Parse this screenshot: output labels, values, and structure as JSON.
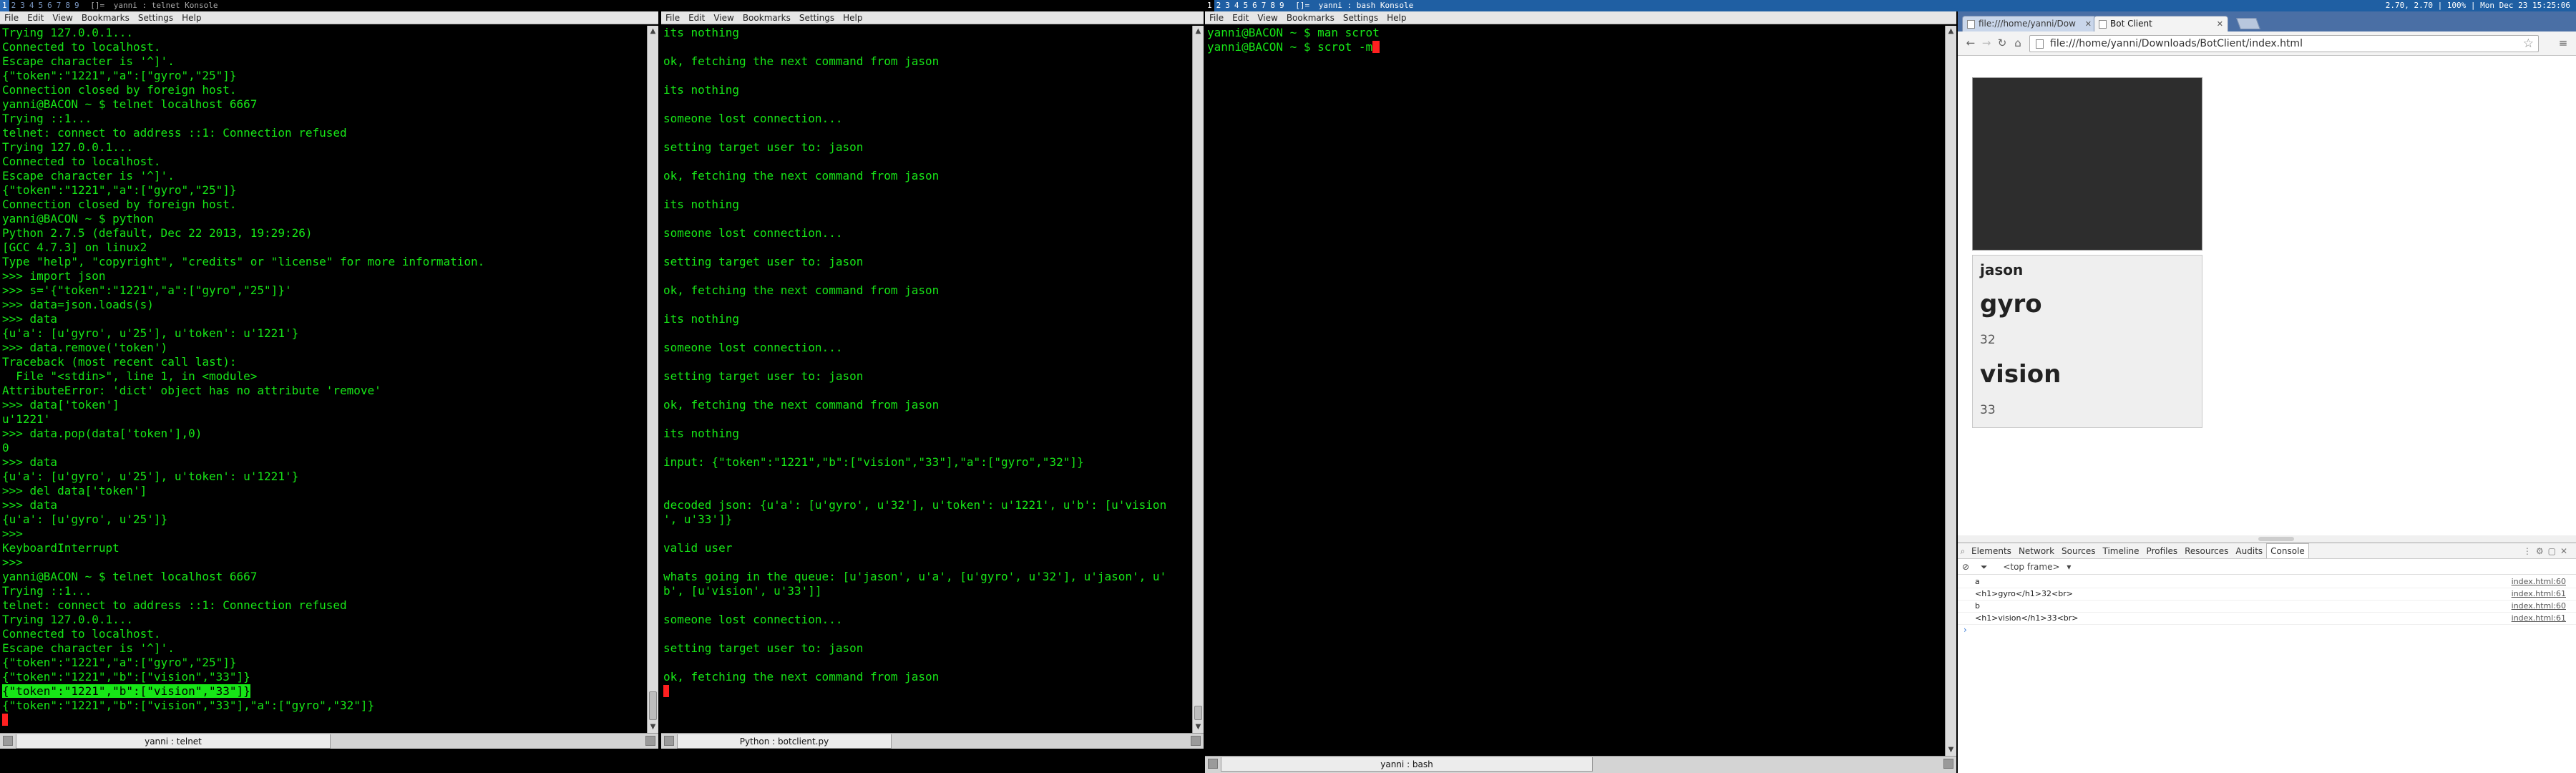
{
  "topbar": {
    "left_tags": [
      "1",
      "2",
      "3",
      "4",
      "5",
      "6",
      "7",
      "8",
      "9"
    ],
    "left_layout": "[]=",
    "left_title": "yanni : telnet  Konsole",
    "mid_tags": [
      "1",
      "2",
      "3",
      "4",
      "5",
      "6",
      "7",
      "8",
      "9"
    ],
    "mid_layout": "[]=",
    "mid_title": "yanni : bash  Konsole",
    "status": "2.70, 2.70 | 100% | Mon Dec 23 15:25:06"
  },
  "terminal1": {
    "menu": [
      "File",
      "Edit",
      "View",
      "Bookmarks",
      "Settings",
      "Help"
    ],
    "lines": [
      "Trying 127.0.0.1...",
      "Connected to localhost.",
      "Escape character is '^]'.",
      "{\"token\":\"1221\",\"a\":[\"gyro\",\"25\"]}",
      "Connection closed by foreign host.",
      "yanni@BACON ~ $ telnet localhost 6667",
      "Trying ::1...",
      "telnet: connect to address ::1: Connection refused",
      "Trying 127.0.0.1...",
      "Connected to localhost.",
      "Escape character is '^]'.",
      "{\"token\":\"1221\",\"a\":[\"gyro\",\"25\"]}",
      "Connection closed by foreign host.",
      "yanni@BACON ~ $ python",
      "Python 2.7.5 (default, Dec 22 2013, 19:29:26)",
      "[GCC 4.7.3] on linux2",
      "Type \"help\", \"copyright\", \"credits\" or \"license\" for more information.",
      ">>> import json",
      ">>> s='{\"token\":\"1221\",\"a\":[\"gyro\",\"25\"]}'",
      ">>> data=json.loads(s)",
      ">>> data",
      "{u'a': [u'gyro', u'25'], u'token': u'1221'}",
      ">>> data.remove('token')",
      "Traceback (most recent call last):",
      "  File \"<stdin>\", line 1, in <module>",
      "AttributeError: 'dict' object has no attribute 'remove'",
      ">>> data['token']",
      "u'1221'",
      ">>> data.pop(data['token'],0)",
      "0",
      ">>> data",
      "{u'a': [u'gyro', u'25'], u'token': u'1221'}",
      ">>> del data['token']",
      ">>> data",
      "{u'a': [u'gyro', u'25']}",
      ">>>",
      "KeyboardInterrupt",
      ">>>",
      "yanni@BACON ~ $ telnet localhost 6667",
      "Trying ::1...",
      "telnet: connect to address ::1: Connection refused",
      "Trying 127.0.0.1...",
      "Connected to localhost.",
      "Escape character is '^]'.",
      "{\"token\":\"1221\",\"a\":[\"gyro\",\"25\"]}",
      "{\"token\":\"1221\",\"b\":[\"vision\",\"33\"]}",
      "{\"token\":\"1221\",\"b\":[\"vision\",\"33\"]}",
      "{\"token\":\"1221\",\"b\":[\"vision\",\"33\"],\"a\":[\"gyro\",\"32\"]}"
    ],
    "tab_label": "yanni : telnet"
  },
  "terminal2": {
    "menu": [
      "File",
      "Edit",
      "View",
      "Bookmarks",
      "Settings",
      "Help"
    ],
    "lines": [
      "its nothing",
      "",
      "ok, fetching the next command from jason",
      "",
      "its nothing",
      "",
      "someone lost connection...",
      "",
      "setting target user to: jason",
      "",
      "ok, fetching the next command from jason",
      "",
      "its nothing",
      "",
      "someone lost connection...",
      "",
      "setting target user to: jason",
      "",
      "ok, fetching the next command from jason",
      "",
      "its nothing",
      "",
      "someone lost connection...",
      "",
      "setting target user to: jason",
      "",
      "ok, fetching the next command from jason",
      "",
      "its nothing",
      "",
      "input: {\"token\":\"1221\",\"b\":[\"vision\",\"33\"],\"a\":[\"gyro\",\"32\"]}",
      "",
      "",
      "decoded json: {u'a': [u'gyro', u'32'], u'token': u'1221', u'b': [u'vision",
      "', u'33']}",
      "",
      "valid user",
      "",
      "whats going in the queue: [u'jason', u'a', [u'gyro', u'32'], u'jason', u'",
      "b', [u'vision', u'33']]",
      "",
      "someone lost connection...",
      "",
      "setting target user to: jason",
      "",
      "ok, fetching the next command from jason"
    ],
    "tab_label": "Python : botclient.py"
  },
  "terminal3": {
    "menu": [
      "File",
      "Edit",
      "View",
      "Bookmarks",
      "Settings",
      "Help"
    ],
    "lines": [
      "yanni@BACON ~ $ man scrot",
      "yanni@BACON ~ $ scrot -m"
    ],
    "tab_label": "yanni : bash"
  },
  "browser": {
    "tabs": [
      {
        "label": "file:///home/yanni/Dow"
      },
      {
        "label": "Bot Client"
      }
    ],
    "url": "file:///home/yanni/Downloads/BotClient/index.html",
    "card": {
      "user": "jason",
      "items": [
        {
          "name": "gyro",
          "value": "32"
        },
        {
          "name": "vision",
          "value": "33"
        }
      ]
    },
    "devtools": {
      "tabs": [
        "Elements",
        "Network",
        "Sources",
        "Timeline",
        "Profiles",
        "Resources",
        "Audits",
        "Console"
      ],
      "active_tab": "Console",
      "frame": "<top frame>",
      "console": [
        {
          "msg": "a",
          "src": "index.html:60"
        },
        {
          "msg": "<h1>gyro</h1>32<br>",
          "src": "index.html:61"
        },
        {
          "msg": "b",
          "src": "index.html:60"
        },
        {
          "msg": "<h1>vision</h1>33<br>",
          "src": "index.html:61"
        }
      ],
      "prompt": "›"
    }
  },
  "colors": {
    "terminal_fg": "#17e617",
    "cursor": "#ff2020"
  }
}
